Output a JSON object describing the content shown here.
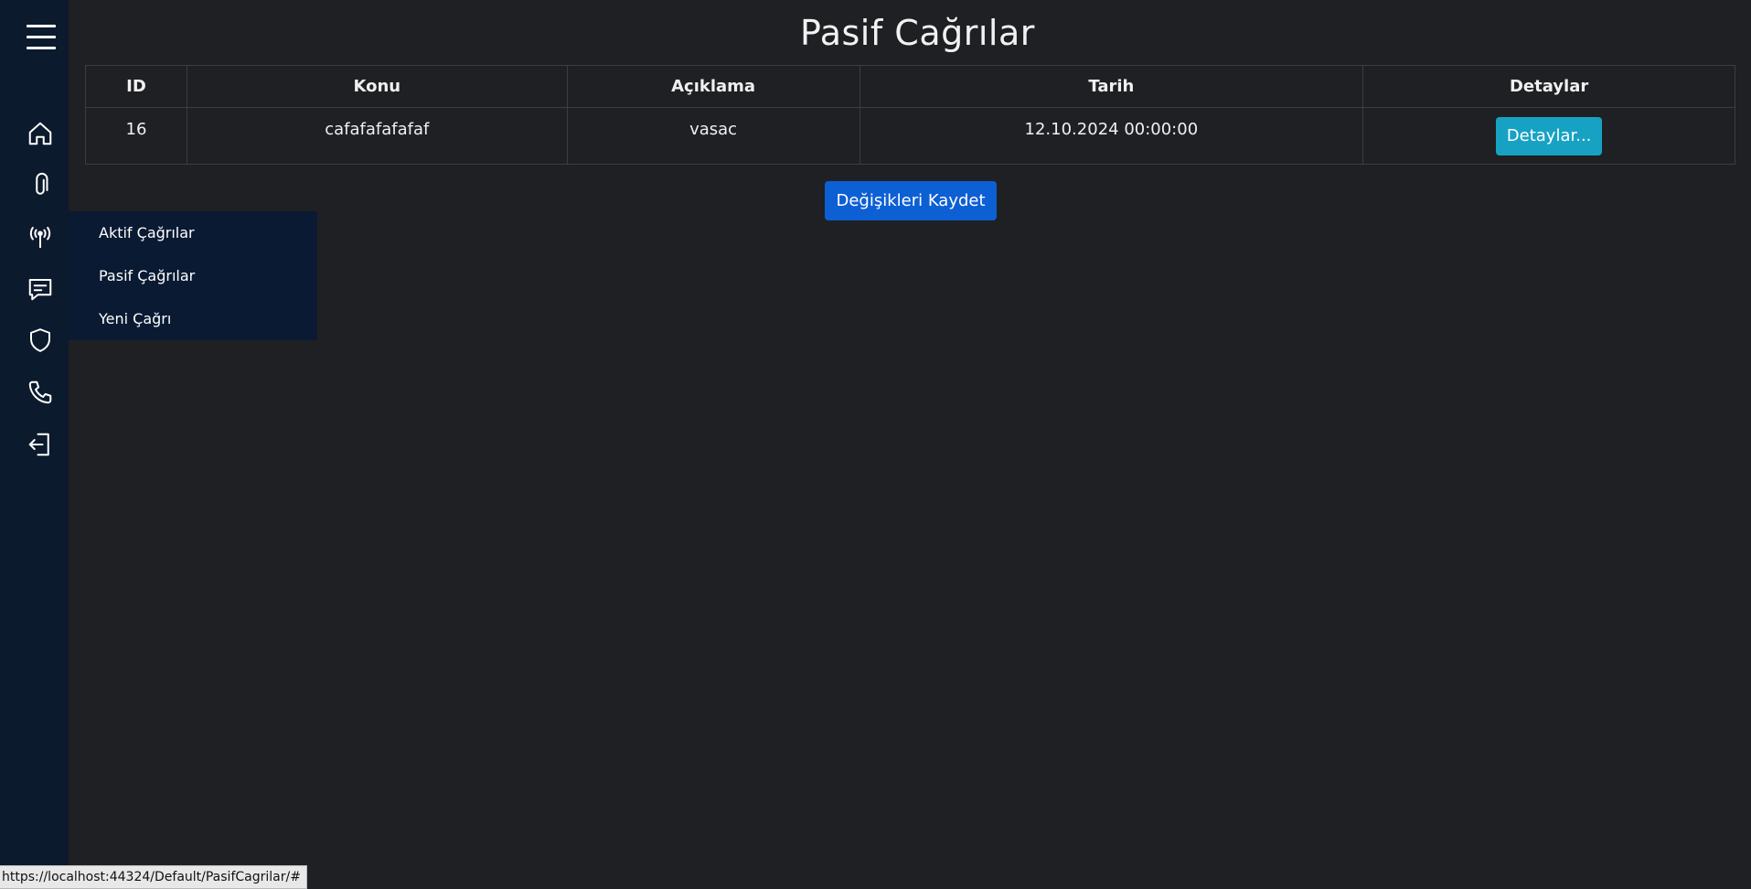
{
  "page": {
    "title": "Pasif Cağrılar"
  },
  "sidebar": {
    "menu_icon": "hamburger-menu-icon",
    "icons": [
      {
        "name": "home-icon"
      },
      {
        "name": "paperclip-icon"
      },
      {
        "name": "antenna-icon"
      },
      {
        "name": "message-icon"
      },
      {
        "name": "shield-icon"
      },
      {
        "name": "phone-icon"
      },
      {
        "name": "logout-icon"
      }
    ],
    "flyout": {
      "items": [
        {
          "label": "Aktif Çağrılar"
        },
        {
          "label": "Pasif Çağrılar"
        },
        {
          "label": "Yeni Çağrı"
        }
      ]
    }
  },
  "table": {
    "columns": [
      "ID",
      "Konu",
      "Açıklama",
      "Tarih",
      "Detaylar"
    ],
    "rows": [
      {
        "id": "16",
        "konu": "cafafafafafaf",
        "aciklama": "vasac",
        "tarih": "12.10.2024 00:00:00",
        "details_label": "Detaylar..."
      }
    ]
  },
  "actions": {
    "save_label": "Değişikleri Kaydet"
  },
  "status_bar": {
    "url": "https://localhost:44324/Default/PasifCagrilar/#"
  },
  "colors": {
    "background": "#1f2023",
    "sidebar": "#0c1a2e",
    "flyout": "#0a1a33",
    "details_button": "#17a2c4",
    "save_button": "#0d5fd4"
  }
}
